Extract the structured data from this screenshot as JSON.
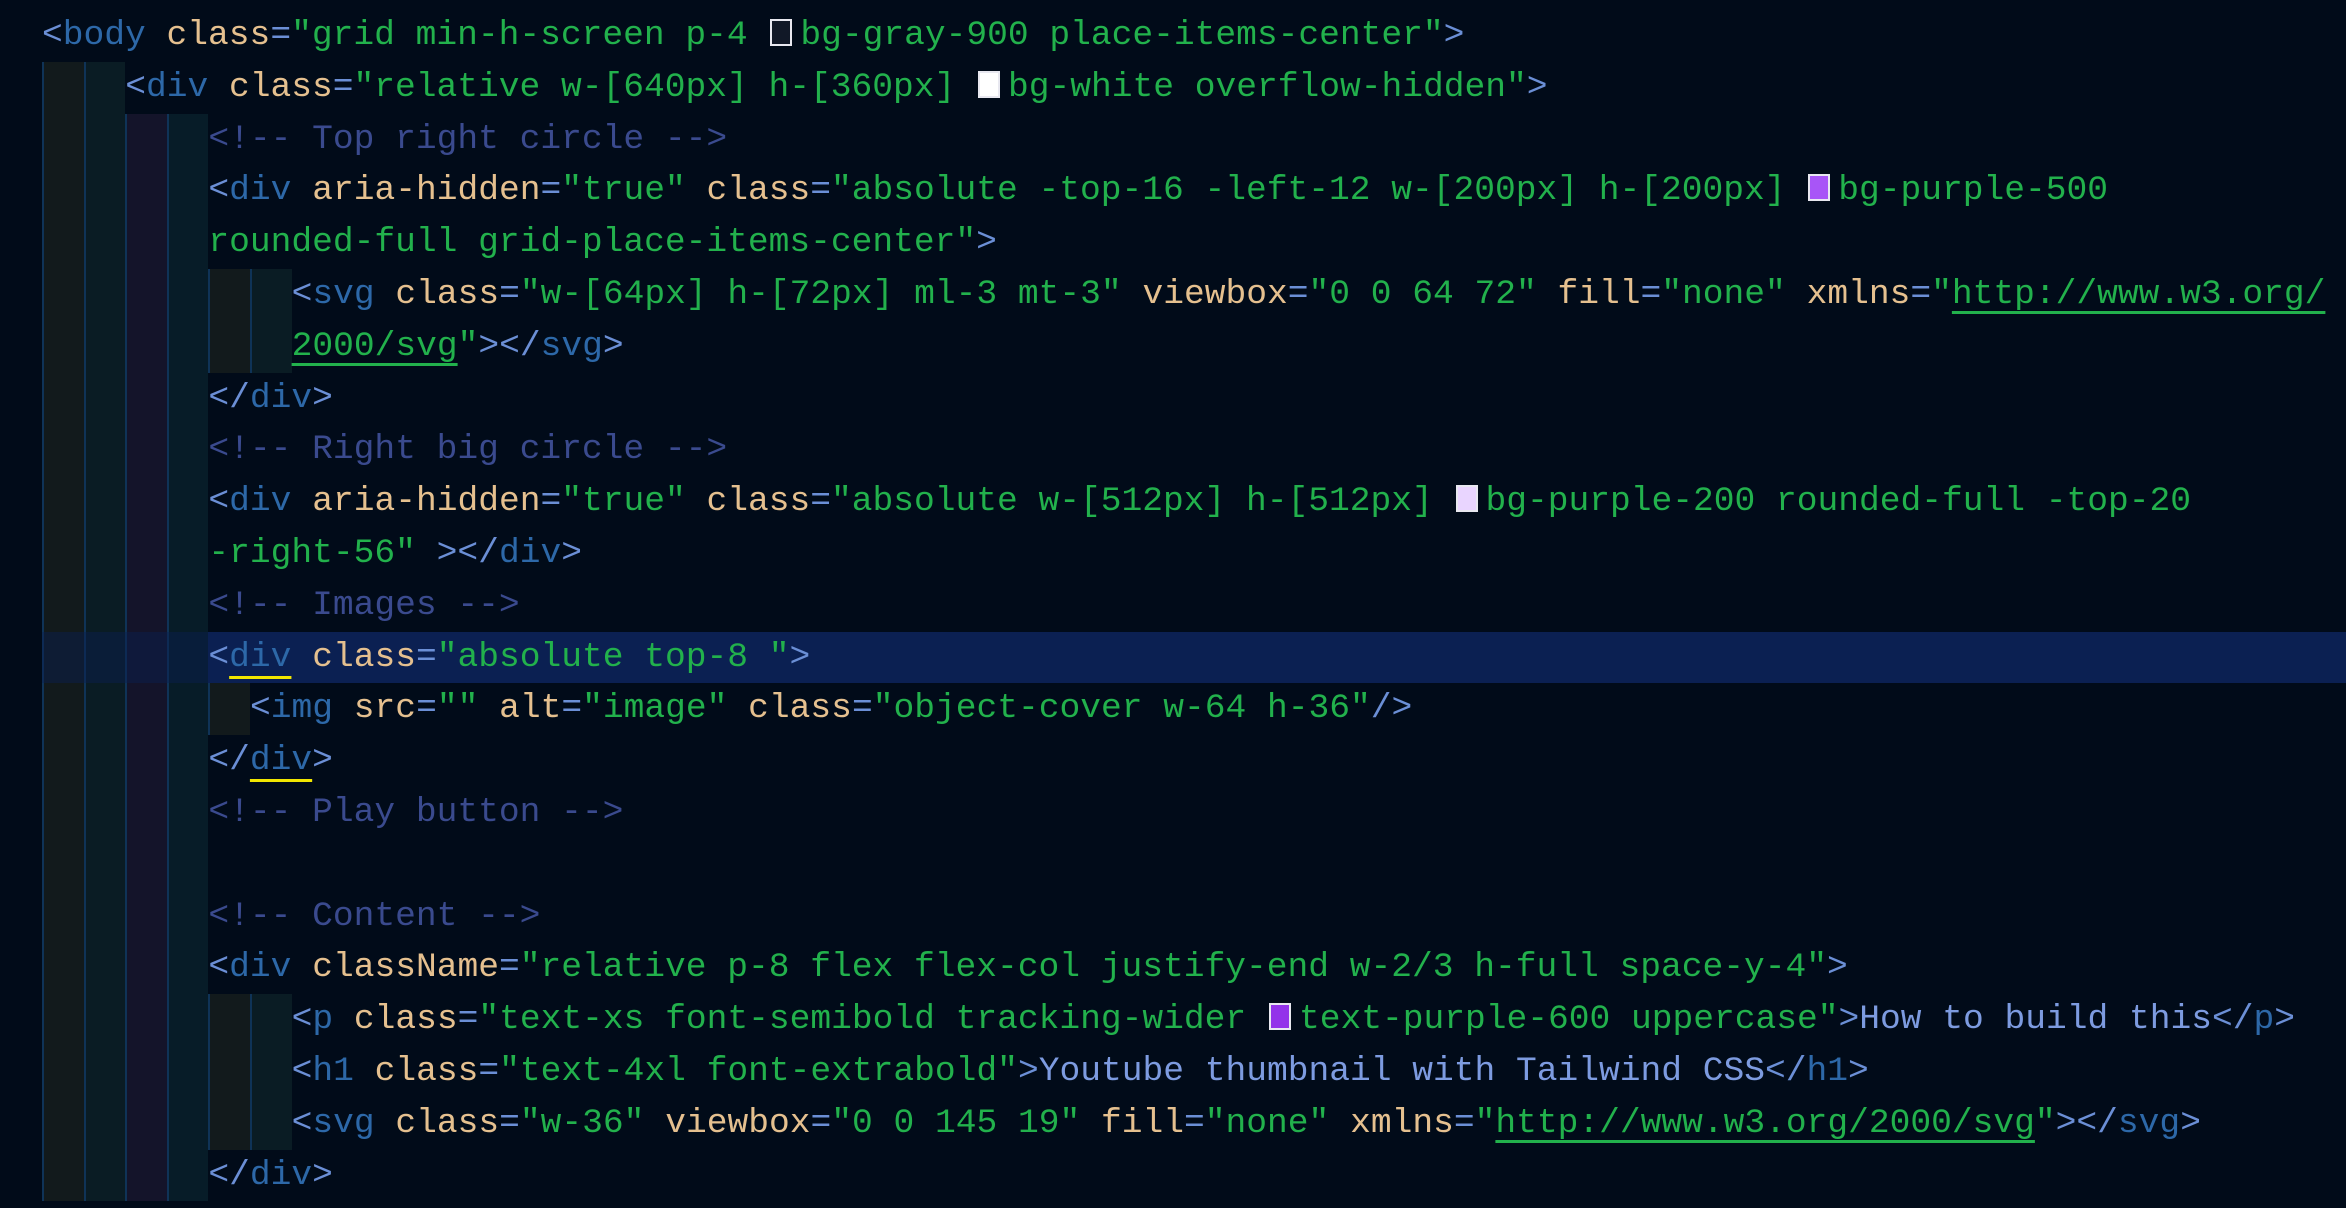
{
  "editor": {
    "theme_colors": {
      "background": "#010b19",
      "highlight_line": "#0b2052",
      "punctuation": "#6b8fd6",
      "tag": "#2d68a8",
      "attribute": "#e5c08f",
      "string": "#22b14c",
      "comment": "#3a4a8e",
      "text": "#7d9be0",
      "bracket_match": "#f2e600"
    },
    "highlighted_line": 12,
    "lines": [
      {
        "indent": 0,
        "tokens": [
          [
            "lt",
            "<"
          ],
          [
            "tag",
            "body"
          ],
          [
            "sp",
            " "
          ],
          [
            "attr",
            "class"
          ],
          [
            "lt",
            "="
          ],
          [
            "str",
            "\"grid min-h-screen p-4 "
          ],
          [
            "sw",
            "#111827"
          ],
          [
            "str",
            "bg-gray-900 place-items-center\""
          ],
          [
            "lt",
            ">"
          ]
        ]
      },
      {
        "indent": 4,
        "tokens": [
          [
            "lt",
            "<"
          ],
          [
            "tag",
            "div"
          ],
          [
            "sp",
            " "
          ],
          [
            "attr",
            "class"
          ],
          [
            "lt",
            "="
          ],
          [
            "str",
            "\"relative w-[640px] h-[360px] "
          ],
          [
            "sw",
            "#ffffff"
          ],
          [
            "str",
            "bg-white overflow-hidden\""
          ],
          [
            "lt",
            ">"
          ]
        ]
      },
      {
        "indent": 8,
        "tokens": [
          [
            "cmt",
            "<!-- Top right circle -->"
          ]
        ]
      },
      {
        "indent": 8,
        "tokens": [
          [
            "lt",
            "<"
          ],
          [
            "tag",
            "div"
          ],
          [
            "sp",
            " "
          ],
          [
            "attr",
            "aria-hidden"
          ],
          [
            "lt",
            "="
          ],
          [
            "str",
            "\"true\""
          ],
          [
            "sp",
            " "
          ],
          [
            "attr",
            "class"
          ],
          [
            "lt",
            "="
          ],
          [
            "str",
            "\"absolute -top-16 -left-12 w-[200px] h-[200px] "
          ],
          [
            "sw",
            "#a855f7"
          ],
          [
            "str",
            "bg-purple-500"
          ]
        ]
      },
      {
        "indent": 8,
        "tokens": [
          [
            "str",
            "rounded-full grid-place-items-center\""
          ],
          [
            "lt",
            ">"
          ]
        ]
      },
      {
        "indent": 12,
        "tokens": [
          [
            "lt",
            "<"
          ],
          [
            "tag",
            "svg"
          ],
          [
            "sp",
            " "
          ],
          [
            "attr",
            "class"
          ],
          [
            "lt",
            "="
          ],
          [
            "str",
            "\"w-[64px] h-[72px] ml-3 mt-3\""
          ],
          [
            "sp",
            " "
          ],
          [
            "attr",
            "viewbox"
          ],
          [
            "lt",
            "="
          ],
          [
            "str",
            "\"0 0 64 72\""
          ],
          [
            "sp",
            " "
          ],
          [
            "attr",
            "fill"
          ],
          [
            "lt",
            "="
          ],
          [
            "str",
            "\"none\""
          ],
          [
            "sp",
            " "
          ],
          [
            "attr",
            "xmlns"
          ],
          [
            "lt",
            "="
          ],
          [
            "str",
            "\""
          ],
          [
            "link",
            "http://www.w3.org/"
          ]
        ]
      },
      {
        "indent": 12,
        "tokens": [
          [
            "link",
            "2000/svg"
          ],
          [
            "str",
            "\""
          ],
          [
            "lt",
            "></"
          ],
          [
            "tag",
            "svg"
          ],
          [
            "lt",
            ">"
          ]
        ]
      },
      {
        "indent": 8,
        "tokens": [
          [
            "lt",
            "</"
          ],
          [
            "tag",
            "div"
          ],
          [
            "lt",
            ">"
          ]
        ]
      },
      {
        "indent": 8,
        "tokens": [
          [
            "cmt",
            "<!-- Right big circle -->"
          ]
        ]
      },
      {
        "indent": 8,
        "tokens": [
          [
            "lt",
            "<"
          ],
          [
            "tag",
            "div"
          ],
          [
            "sp",
            " "
          ],
          [
            "attr",
            "aria-hidden"
          ],
          [
            "lt",
            "="
          ],
          [
            "str",
            "\"true\""
          ],
          [
            "sp",
            " "
          ],
          [
            "attr",
            "class"
          ],
          [
            "lt",
            "="
          ],
          [
            "str",
            "\"absolute w-[512px] h-[512px] "
          ],
          [
            "sw",
            "#e9d5ff"
          ],
          [
            "str",
            "bg-purple-200 rounded-full -top-20"
          ]
        ]
      },
      {
        "indent": 8,
        "tokens": [
          [
            "str",
            "-right-56\""
          ],
          [
            "sp",
            " "
          ],
          [
            "lt",
            "></"
          ],
          [
            "tag",
            "div"
          ],
          [
            "lt",
            ">"
          ]
        ]
      },
      {
        "indent": 8,
        "tokens": [
          [
            "cmt",
            "<!-- Images -->"
          ]
        ]
      },
      {
        "indent": 8,
        "tokens": [
          [
            "lt",
            "<"
          ],
          [
            "match",
            "div"
          ],
          [
            "sp",
            " "
          ],
          [
            "attr",
            "class"
          ],
          [
            "lt",
            "="
          ],
          [
            "str",
            "\"absolute top-8 \""
          ],
          [
            "lt",
            ">"
          ]
        ]
      },
      {
        "indent": 10,
        "tokens": [
          [
            "lt",
            "<"
          ],
          [
            "tag",
            "img"
          ],
          [
            "sp",
            " "
          ],
          [
            "attr",
            "src"
          ],
          [
            "lt",
            "="
          ],
          [
            "str",
            "\"\""
          ],
          [
            "sp",
            " "
          ],
          [
            "attr",
            "alt"
          ],
          [
            "lt",
            "="
          ],
          [
            "str",
            "\"image\""
          ],
          [
            "sp",
            " "
          ],
          [
            "attr",
            "class"
          ],
          [
            "lt",
            "="
          ],
          [
            "str",
            "\"object-cover w-64 h-36\""
          ],
          [
            "lt",
            "/>"
          ]
        ]
      },
      {
        "indent": 8,
        "tokens": [
          [
            "lt",
            "</"
          ],
          [
            "match",
            "div"
          ],
          [
            "lt",
            ">"
          ]
        ]
      },
      {
        "indent": 8,
        "tokens": [
          [
            "cmt",
            "<!-- Play button -->"
          ]
        ]
      },
      {
        "indent": 8,
        "tokens": []
      },
      {
        "indent": 8,
        "tokens": [
          [
            "cmt",
            "<!-- Content -->"
          ]
        ]
      },
      {
        "indent": 8,
        "tokens": [
          [
            "lt",
            "<"
          ],
          [
            "tag",
            "div"
          ],
          [
            "sp",
            " "
          ],
          [
            "attr",
            "className"
          ],
          [
            "lt",
            "="
          ],
          [
            "str",
            "\"relative p-8 flex flex-col justify-end w-2/3 h-full space-y-4\""
          ],
          [
            "lt",
            ">"
          ]
        ]
      },
      {
        "indent": 12,
        "tokens": [
          [
            "lt",
            "<"
          ],
          [
            "tag",
            "p"
          ],
          [
            "sp",
            " "
          ],
          [
            "attr",
            "class"
          ],
          [
            "lt",
            "="
          ],
          [
            "str",
            "\"text-xs font-semibold tracking-wider "
          ],
          [
            "sw",
            "#9333ea"
          ],
          [
            "str",
            "text-purple-600 uppercase\""
          ],
          [
            "lt",
            ">"
          ],
          [
            "txt",
            "How to build this"
          ],
          [
            "lt",
            "</"
          ],
          [
            "tag",
            "p"
          ],
          [
            "lt",
            ">"
          ]
        ]
      },
      {
        "indent": 12,
        "tokens": [
          [
            "lt",
            "<"
          ],
          [
            "tag",
            "h1"
          ],
          [
            "sp",
            " "
          ],
          [
            "attr",
            "class"
          ],
          [
            "lt",
            "="
          ],
          [
            "str",
            "\"text-4xl font-extrabold\""
          ],
          [
            "lt",
            ">"
          ],
          [
            "txt",
            "Youtube thumbnail with Tailwind CSS"
          ],
          [
            "lt",
            "</"
          ],
          [
            "tag",
            "h1"
          ],
          [
            "lt",
            ">"
          ]
        ]
      },
      {
        "indent": 12,
        "tokens": [
          [
            "lt",
            "<"
          ],
          [
            "tag",
            "svg"
          ],
          [
            "sp",
            " "
          ],
          [
            "attr",
            "class"
          ],
          [
            "lt",
            "="
          ],
          [
            "str",
            "\"w-36\""
          ],
          [
            "sp",
            " "
          ],
          [
            "attr",
            "viewbox"
          ],
          [
            "lt",
            "="
          ],
          [
            "str",
            "\"0 0 145 19\""
          ],
          [
            "sp",
            " "
          ],
          [
            "attr",
            "fill"
          ],
          [
            "lt",
            "="
          ],
          [
            "str",
            "\"none\""
          ],
          [
            "sp",
            " "
          ],
          [
            "attr",
            "xmlns"
          ],
          [
            "lt",
            "="
          ],
          [
            "str",
            "\""
          ],
          [
            "link",
            "http://www.w3.org/2000/svg"
          ],
          [
            "str",
            "\""
          ],
          [
            "lt",
            "></"
          ],
          [
            "tag",
            "svg"
          ],
          [
            "lt",
            ">"
          ]
        ]
      },
      {
        "indent": 8,
        "tokens": [
          [
            "lt",
            "</"
          ],
          [
            "tag",
            "div"
          ],
          [
            "lt",
            ">"
          ]
        ]
      }
    ]
  }
}
